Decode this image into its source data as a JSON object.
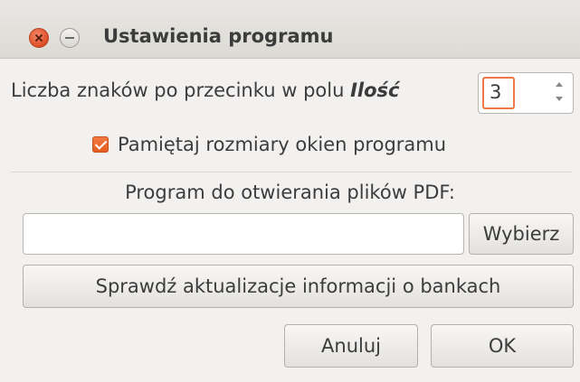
{
  "window": {
    "title": "Ustawienia programu"
  },
  "decimal_places": {
    "label": "Liczba znaków po przecinku w polu ",
    "field_name": "Ilość",
    "value": "3"
  },
  "remember_windows": {
    "label": "Pamiętaj rozmiary okien programu",
    "checked": true
  },
  "pdf_program": {
    "label": "Program do otwierania plików PDF:",
    "value": "",
    "choose_label": "Wybierz"
  },
  "update_button_label": "Sprawdź aktualizacje informacji o bankach",
  "footer": {
    "cancel_label": "Anuluj",
    "ok_label": "OK"
  },
  "colors": {
    "accent": "#f07746",
    "background": "#f2f1f0"
  }
}
